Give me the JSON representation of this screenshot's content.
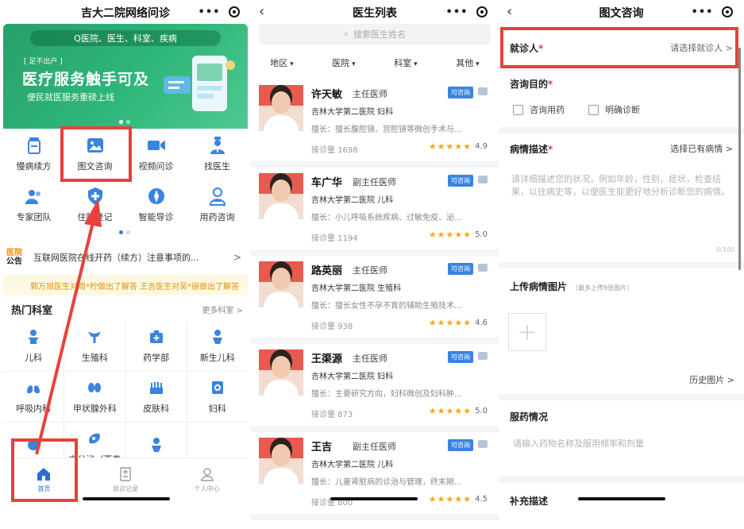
{
  "screen_home": {
    "title": "吉大二院网络问诊",
    "search_placeholder": "Q医院、医生、科室、疾病",
    "banner": {
      "tag": "[ 足不出户 ]",
      "slogan": "医疗服务触手可及",
      "subtitle": "便民就医服务重磅上线"
    },
    "services": [
      {
        "label": "慢病续方",
        "icon": "prescription-icon"
      },
      {
        "label": "图文咨询",
        "icon": "image-consult-icon"
      },
      {
        "label": "视频问诊",
        "icon": "video-icon"
      },
      {
        "label": "找医生",
        "icon": "doctor-icon"
      },
      {
        "label": "专家团队",
        "icon": "team-icon"
      },
      {
        "label": "住院登记",
        "icon": "hospital-register-icon"
      },
      {
        "label": "智能导诊",
        "icon": "smart-guide-icon"
      },
      {
        "label": "用药咨询",
        "icon": "medication-icon"
      }
    ],
    "notice": {
      "badge_top": "医院",
      "badge_bottom": "公告",
      "text": "互联网医院在线开药（续方）注意事项的...",
      "marquee": "郭万旭医生对周*柠做出了解答 王吉医生对吴*丽做出了解答"
    },
    "departments_title": "热门科室",
    "departments_more": "更多科室 >",
    "departments": [
      "儿科",
      "生殖科",
      "药学部",
      "新生儿科",
      "呼吸内科",
      "甲状腺外科",
      "皮肤科",
      "妇科",
      "",
      "内分泌（亚泰",
      "",
      ""
    ],
    "tabs": [
      {
        "label": "首页",
        "icon": "home-icon"
      },
      {
        "label": "就诊记录",
        "icon": "record-icon"
      },
      {
        "label": "个人中心",
        "icon": "user-icon"
      }
    ],
    "colors": {
      "brand_green": "#2fb77a",
      "accent_blue": "#2b6fd6",
      "highlight_red": "#e8413b"
    }
  },
  "screen_doctors": {
    "title": "医生列表",
    "search_placeholder": "搜索医生姓名",
    "filters": [
      "地区",
      "医院",
      "科室",
      "其他"
    ],
    "doctors": [
      {
        "name": "许天敏",
        "title": "主任医师",
        "badge": "可咨询",
        "hospital": "吉林大学第二医院 妇科",
        "skill": "擅长：擅长腹腔镜、宫腔镜等微创手术与...",
        "count": "接诊量 1698",
        "rating": "4.9",
        "stars": "★★★★★"
      },
      {
        "name": "车广华",
        "title": "副主任医师",
        "badge": "可咨询",
        "hospital": "吉林大学第二医院 儿科",
        "skill": "擅长：小儿呼吸系统疾病、过敏免疫、泌...",
        "count": "接诊量 1194",
        "rating": "5.0",
        "stars": "★★★★★"
      },
      {
        "name": "路英丽",
        "title": "主任医师",
        "badge": "可咨询",
        "hospital": "吉林大学第二医院 生殖科",
        "skill": "擅长：擅长女性不孕不育的辅助生殖技术...",
        "count": "接诊量 938",
        "rating": "4.6",
        "stars": "★★★★★"
      },
      {
        "name": "王渠源",
        "title": "主任医师",
        "badge": "可咨询",
        "hospital": "吉林大学第二医院 妇科",
        "skill": "擅长：主要研究方向，妇科微创及妇科肿...",
        "count": "接诊量 873",
        "rating": "5.0",
        "stars": "★★★★★"
      },
      {
        "name": "王吉",
        "title": "副主任医师",
        "badge": "可咨询",
        "hospital": "吉林大学第二医院 儿科",
        "skill": "擅长：儿童肾脏病的诊治与管理，终末期...",
        "count": "接诊量 800",
        "rating": "4.5",
        "stars": "★★★★★"
      }
    ]
  },
  "screen_consult": {
    "title": "图文咨询",
    "patient_label": "就诊人",
    "patient_value": "请选择就诊人 >",
    "purpose_label": "咨询目的",
    "purpose_options": [
      "咨询用药",
      "明确诊断"
    ],
    "condition_label": "病情描述",
    "condition_value": "选择已有病情 >",
    "condition_placeholder": "请详细描述您的状况，例如年龄，性别，症状，检查结果，以往病史等，以便医生能更好地分析诊断您的病情。",
    "counter": "0/100",
    "upload_label": "上传病情图片",
    "upload_hint": "（最多上传9张图片）",
    "upload_plus": "+",
    "history": "历史图片 >",
    "medication_label": "服药情况",
    "medication_placeholder": "请输入药物名称及服用频率和剂量",
    "supplement_label": "补充描述",
    "required_mark": "*"
  }
}
